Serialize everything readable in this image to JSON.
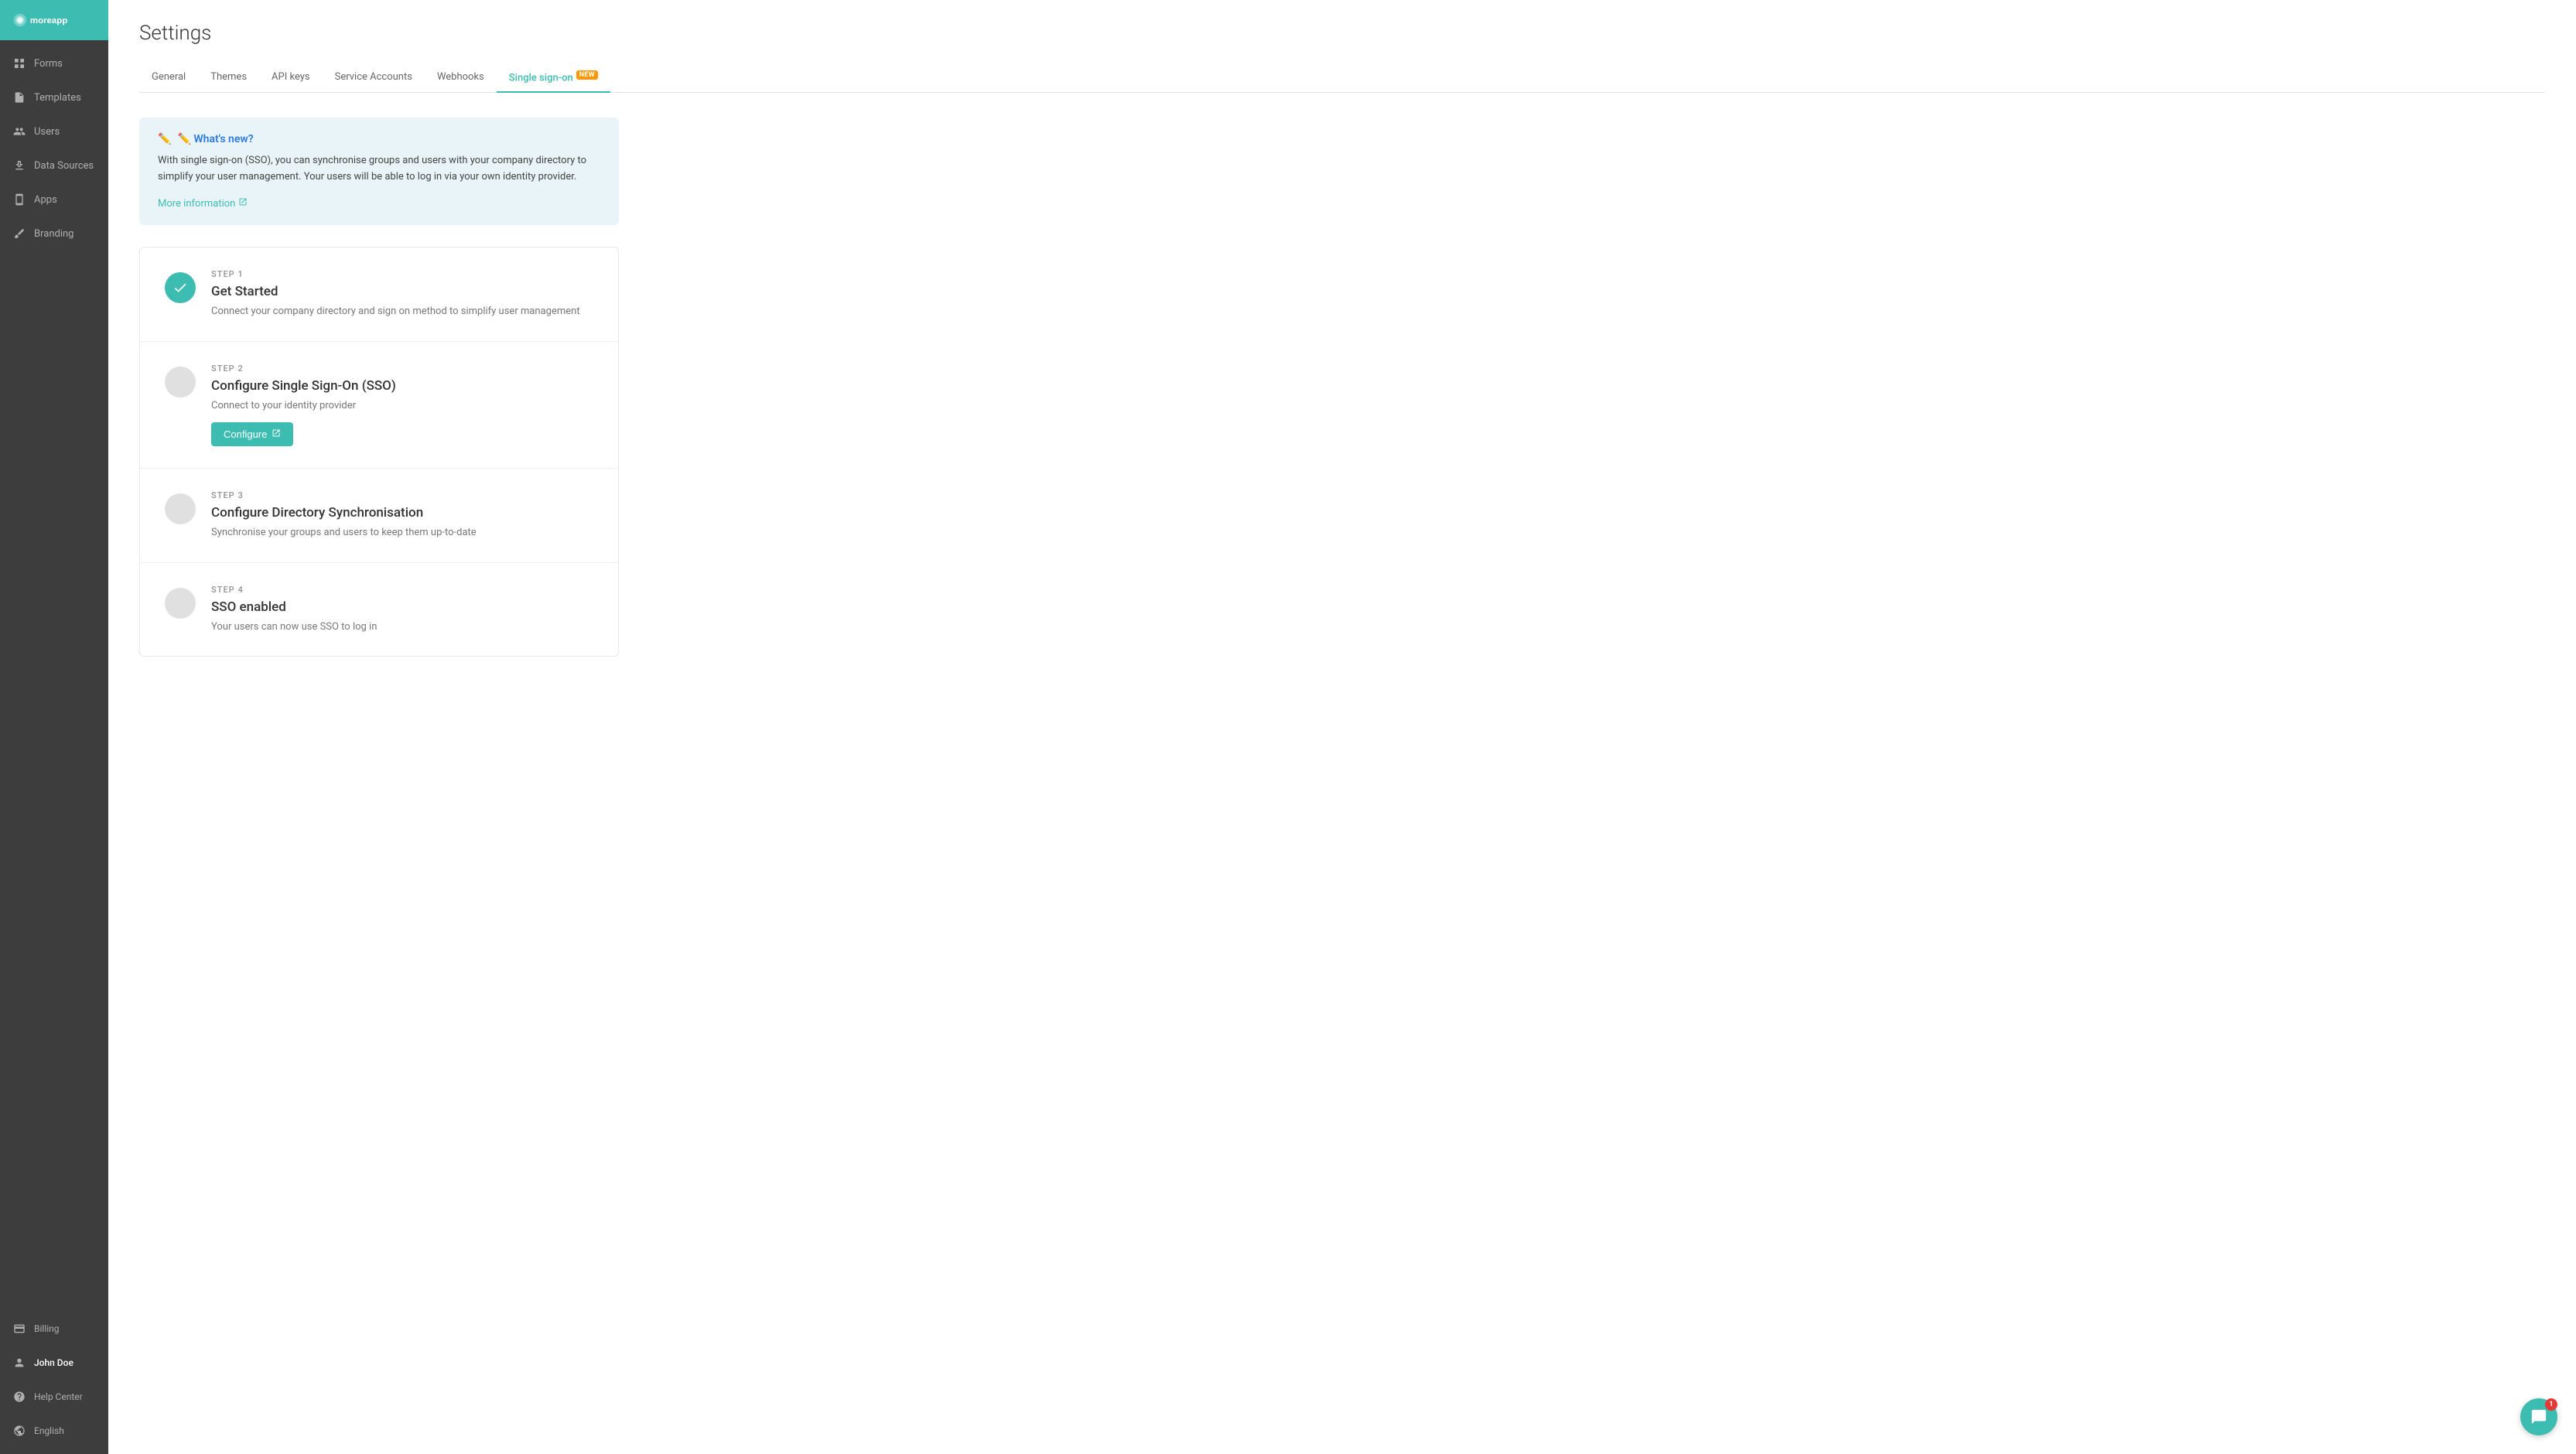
{
  "sidebar": {
    "logo_alt": "MoreApp",
    "items": [
      {
        "id": "forms",
        "label": "Forms",
        "icon": "grid-icon"
      },
      {
        "id": "templates",
        "label": "Templates",
        "icon": "file-icon"
      },
      {
        "id": "users",
        "label": "Users",
        "icon": "users-icon"
      },
      {
        "id": "data-sources",
        "label": "Data Sources",
        "icon": "download-icon"
      },
      {
        "id": "apps",
        "label": "Apps",
        "icon": "tablet-icon"
      },
      {
        "id": "branding",
        "label": "Branding",
        "icon": "brush-icon"
      }
    ],
    "bottom_items": [
      {
        "id": "billing",
        "label": "Billing",
        "icon": "billing-icon"
      },
      {
        "id": "john-doe",
        "label": "John Doe",
        "icon": "person-icon"
      },
      {
        "id": "help-center",
        "label": "Help Center",
        "icon": "help-icon"
      },
      {
        "id": "english",
        "label": "English",
        "icon": "globe-icon"
      }
    ]
  },
  "header": {
    "title": "Settings"
  },
  "tabs": [
    {
      "id": "general",
      "label": "General",
      "active": false,
      "badge": null
    },
    {
      "id": "themes",
      "label": "Themes",
      "active": false,
      "badge": null
    },
    {
      "id": "api-keys",
      "label": "API keys",
      "active": false,
      "badge": null
    },
    {
      "id": "service-accounts",
      "label": "Service Accounts",
      "active": false,
      "badge": null
    },
    {
      "id": "webhooks",
      "label": "Webhooks",
      "active": false,
      "badge": null
    },
    {
      "id": "single-sign-on",
      "label": "Single sign-on",
      "active": true,
      "badge": "NEW"
    }
  ],
  "info_box": {
    "title": "✏️ What's new?",
    "text": "With single sign-on (SSO), you can synchronise groups and users with your company directory to simplify your user management. Your users will be able to log in via your own identity provider.",
    "link_label": "More information",
    "link_icon": "external-link-icon"
  },
  "steps": [
    {
      "id": "step-1",
      "label": "STEP 1",
      "title": "Get Started",
      "desc": "Connect your company directory and sign on method to simplify user management",
      "completed": true,
      "has_button": false
    },
    {
      "id": "step-2",
      "label": "STEP 2",
      "title": "Configure Single Sign-On (SSO)",
      "desc": "Connect to your identity provider",
      "completed": false,
      "has_button": true,
      "button_label": "Configure"
    },
    {
      "id": "step-3",
      "label": "STEP 3",
      "title": "Configure Directory Synchronisation",
      "desc": "Synchronise your groups and users to keep them up-to-date",
      "completed": false,
      "has_button": false
    },
    {
      "id": "step-4",
      "label": "STEP 4",
      "title": "SSO enabled",
      "desc": "Your users can now use SSO to log in",
      "completed": false,
      "has_button": false
    }
  ],
  "chat": {
    "badge_count": "1"
  }
}
